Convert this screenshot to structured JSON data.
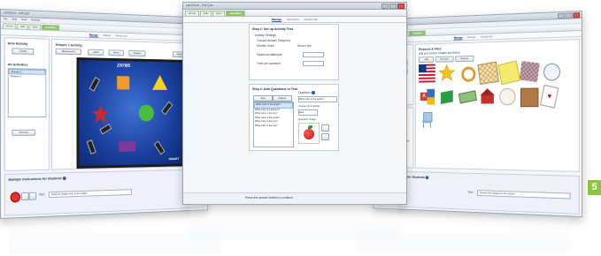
{
  "badge": {
    "number": "5",
    "color": "#8cc63f"
  },
  "colors": {
    "accent_green": "#8fc36a",
    "help_blue": "#2b4fb4",
    "board_blue": "#1a3f9c"
  },
  "left_window": {
    "title": "LanSchool - Edit Quiz",
    "menus": [
      "File",
      "Help",
      "Tools",
      "Settings"
    ],
    "tabs": [
      "Home",
      "Edit",
      "Quiz",
      "Activities"
    ],
    "subtabs": [
      "Manage",
      "Shapes",
      "Activity Info"
    ],
    "left_panel": {
      "title": "New Activity",
      "create_button": "Create",
      "list_title": "All Activities",
      "items": [
        "Shapes 1",
        "Shapes 2"
      ],
      "remove_button": "Remove"
    },
    "main": {
      "title": "Shapes 1 Activity",
      "toolbar": [
        "Background",
        "Label",
        "Items",
        "Shapes",
        "Draw"
      ],
      "board_text": "ZAYMS",
      "board_brand": "SMART"
    },
    "bottom": {
      "title": "Multiple Instructions for Students",
      "text_label": "Text:",
      "text_value": "Drag the shape next to the shape"
    }
  },
  "center_window": {
    "title": "LanSchool - Edit Quiz",
    "tabs": [
      "Home",
      "Edit",
      "Quiz",
      "Activities"
    ],
    "subtabs": [
      "Manage",
      "Questions",
      "Activity Info"
    ],
    "step1_title": "Step 1: Set up Activity Test",
    "step1_rows": [
      "Activity Settings",
      "Correct Answer Required",
      "Shuffle Order",
      "Show Hint",
      "Maximum attempts",
      "Time per question"
    ],
    "step2_title": "Step 2: Add Questions to Test",
    "step2_buttons": [
      "Add",
      "Delete"
    ],
    "questions": [
      "What color is the apple?",
      "What color is a banana?",
      "What color is the sky?",
      "What color is the grass?",
      "What color is the sun?",
      "What color is the sea?"
    ],
    "question_label": "Question:",
    "question_value": "What color is the apple?",
    "answer_label": "Answer (1-2 words):",
    "answer_value": "Red",
    "image_label": "Question Image:",
    "status_text": "Press the answer button to continue"
  },
  "right_window": {
    "title": "LanSchool - Edit Quiz",
    "menus": [
      "File",
      "Help",
      "Tools",
      "Settings"
    ],
    "tabs": [
      "Home",
      "Edit",
      "Quiz",
      "Activities"
    ],
    "subtabs": [
      "Manage",
      "Pictures",
      "Activity Info"
    ],
    "bg_title": "Background Image",
    "pictures_title": "Pictures & Files",
    "pictures_hint": "Add and remove images and videos",
    "pictures_buttons": [
      "Add",
      "Remove",
      "Browse"
    ],
    "scaling_title": "Scaling Options",
    "scaling_rows": [
      "Presentation Mode",
      "Fit presentation scaling",
      "Range of scaling",
      "Min",
      "Auto",
      "Max"
    ],
    "bottom_title": "Audio Instructions for Students",
    "text_label": "Text:",
    "text_value": "Choose the shapes to the picture"
  }
}
